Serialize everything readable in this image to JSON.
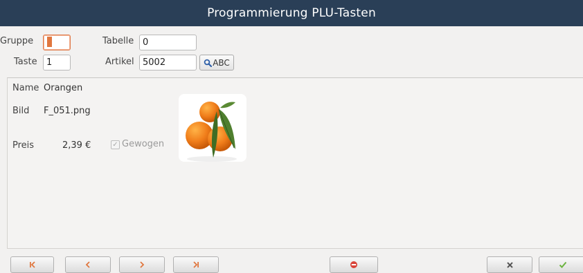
{
  "window": {
    "title": "Programmierung PLU-Tasten"
  },
  "form": {
    "gruppe_label": "Gruppe",
    "gruppe_value": "1",
    "tabelle_label": "Tabelle",
    "tabelle_value": "0",
    "taste_label": "Taste",
    "taste_value": "1",
    "artikel_label": "Artikel",
    "artikel_value": "5002",
    "search_button_label": "ABC"
  },
  "details": {
    "name_label": "Name",
    "name_value": "Orangen",
    "bild_label": "Bild",
    "bild_value": "F_051.png",
    "preis_label": "Preis",
    "preis_value": "2,39 €",
    "gewogen_label": "Gewogen",
    "gewogen_checked": true
  },
  "colors": {
    "titlebar": "#2a3f57",
    "focus_border": "#e07a4a",
    "nav_arrow": "#e0773f",
    "cancel_red": "#d9453a",
    "ok_green": "#6cb33f"
  },
  "icons": {
    "first": "skip-first-icon",
    "prev": "chevron-left-icon",
    "next": "chevron-right-icon",
    "last": "skip-last-icon",
    "cancel": "no-entry-icon",
    "close": "close-icon",
    "ok": "checkmark-icon",
    "search": "magnifier-icon"
  }
}
